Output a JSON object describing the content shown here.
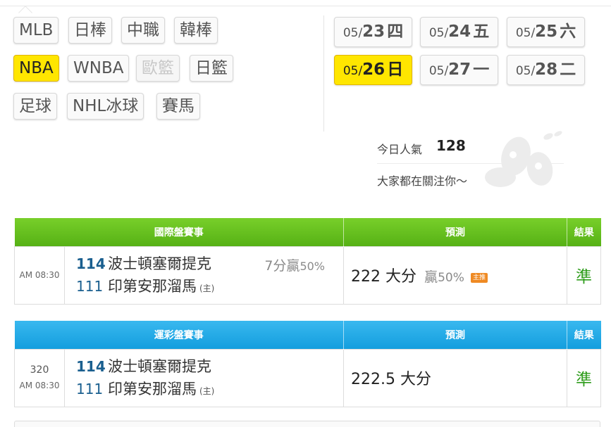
{
  "sports": [
    {
      "label": "MLB",
      "state": "normal"
    },
    {
      "label": "日棒",
      "state": "normal"
    },
    {
      "label": "中職",
      "state": "normal"
    },
    {
      "label": "韓棒",
      "state": "normal"
    },
    {
      "label": "NBA",
      "state": "active"
    },
    {
      "label": "WNBA",
      "state": "normal"
    },
    {
      "label": "歐籃",
      "state": "disabled"
    },
    {
      "label": "日籃",
      "state": "normal"
    },
    {
      "label": "足球",
      "state": "normal"
    },
    {
      "label": "NHL冰球",
      "state": "normal"
    },
    {
      "label": "賽馬",
      "state": "normal"
    }
  ],
  "dates": [
    {
      "month": "05/",
      "day": "23",
      "weekday": "四",
      "active": false
    },
    {
      "month": "05/",
      "day": "24",
      "weekday": "五",
      "active": false
    },
    {
      "month": "05/",
      "day": "25",
      "weekday": "六",
      "active": false
    },
    {
      "month": "05/",
      "day": "26",
      "weekday": "日",
      "active": true
    },
    {
      "month": "05/",
      "day": "27",
      "weekday": "一",
      "active": false
    },
    {
      "month": "05/",
      "day": "28",
      "weekday": "二",
      "active": false
    }
  ],
  "popularity": {
    "label": "今日人氣",
    "value": "128",
    "message": "大家都在關注你〜"
  },
  "international_table": {
    "headers": {
      "match": "國際盤賽事",
      "predict": "預測",
      "result": "結果"
    },
    "game": {
      "number": "",
      "time": "AM 08:30",
      "away_score": "114",
      "away_team": "波士頓塞爾提克",
      "home_score": "111",
      "home_team": "印第安那溜馬",
      "home_tag": "(主)",
      "spread_text": "7分贏",
      "spread_pct": "50%",
      "prediction": "222 大分",
      "prediction_win_text": "贏",
      "prediction_win_pct": "50%",
      "badge": "主推",
      "result": "準"
    }
  },
  "lottery_table": {
    "headers": {
      "match": "運彩盤賽事",
      "predict": "預測",
      "result": "結果"
    },
    "game": {
      "number": "320",
      "time": "AM 08:30",
      "away_score": "114",
      "away_team": "波士頓塞爾提克",
      "home_score": "111",
      "home_team": "印第安那溜馬",
      "home_tag": "(主)",
      "prediction": "222.5 大分",
      "result": "準"
    }
  },
  "colors": {
    "active_yellow": "#ffe600",
    "green_header": "#5ab818",
    "blue_header": "#1ea6e4",
    "score_blue": "#1a5f8f",
    "result_green": "#2f9d1c",
    "badge_orange": "#ef8a23"
  }
}
